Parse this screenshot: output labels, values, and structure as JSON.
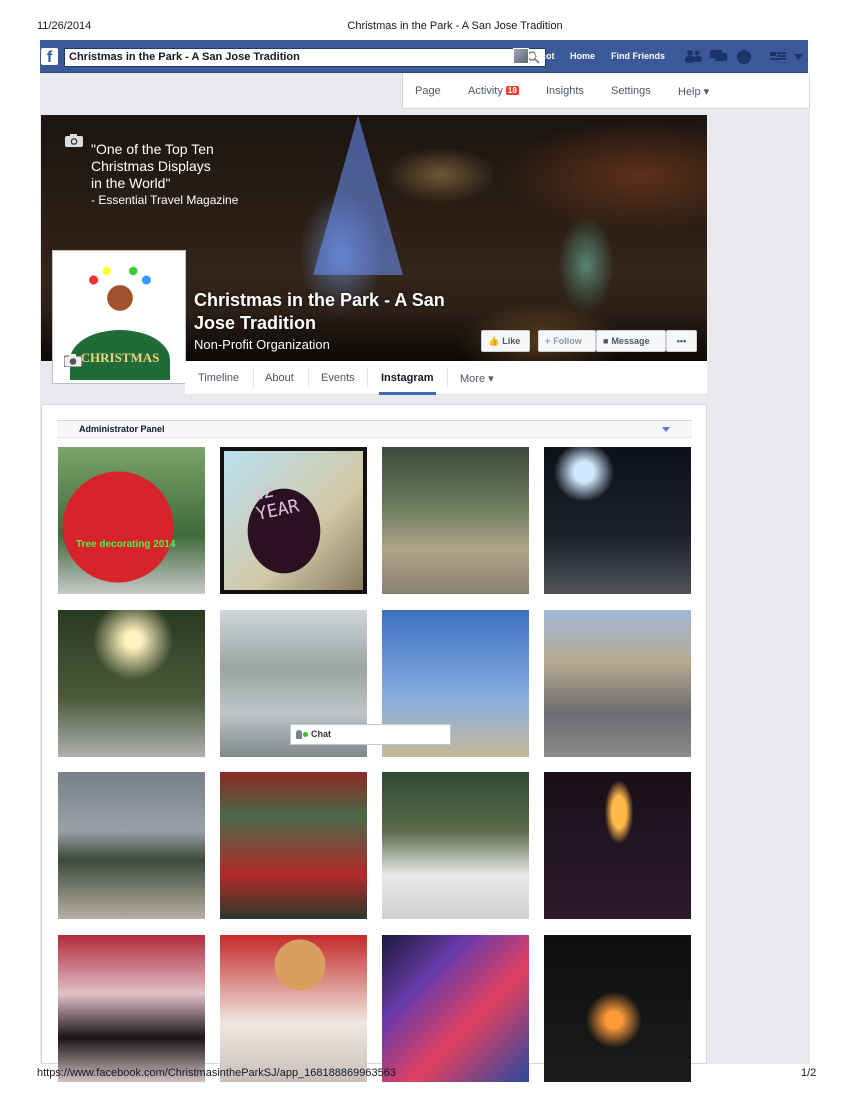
{
  "print_header": {
    "date": "11/26/2014",
    "title": "Christmas in the Park - A San Jose Tradition"
  },
  "print_footer": {
    "url": "https://www.facebook.com/ChristmasintheParkSJ/app_168188869963563",
    "page": "1/2"
  },
  "topbar": {
    "logo": "f",
    "search_value": "Christmas in the Park - A San Jose Tradition",
    "user_name": "Scot",
    "home": "Home",
    "find_friends": "Find Friends",
    "icons": [
      "friend-requests-icon",
      "messages-icon",
      "notifications-icon",
      "privacy-icon",
      "settings-icon"
    ]
  },
  "admin_tabs": {
    "page": "Page",
    "activity": "Activity",
    "activity_count": "18",
    "insights": "Insights",
    "settings": "Settings",
    "help": "Help ▾"
  },
  "cover": {
    "quote_line1": "\"One of the Top Ten",
    "quote_line2": "Christmas Displays",
    "quote_line3": "in the World\"",
    "quote_attr": " - Essential Travel Magazine"
  },
  "profile": {
    "name": "Christmas in the Park - A San Jose Tradition",
    "category": "Non-Profit Organization",
    "logo_text": "CHRISTMAS"
  },
  "actions": {
    "like": "Like",
    "follow": "Follow",
    "message": "Message",
    "more": "•••"
  },
  "page_tabs": {
    "timeline": "Timeline",
    "about": "About",
    "events": "Events",
    "instagram": "Instagram",
    "more": "More ▾"
  },
  "admin_panel": {
    "label": "Administrator Panel"
  },
  "photos": [
    {
      "alt": "red-ornament",
      "caption": "Tree decorating 2014"
    },
    {
      "alt": "hand-written-sign",
      "caption": "12\nYEAR"
    },
    {
      "alt": "family-photo",
      "caption": ""
    },
    {
      "alt": "night-street",
      "caption": ""
    },
    {
      "alt": "park-path",
      "caption": ""
    },
    {
      "alt": "orchard-booth",
      "caption": ""
    },
    {
      "alt": "palm-trees-building",
      "caption": ""
    },
    {
      "alt": "group-plaza",
      "caption": ""
    },
    {
      "alt": "tall-tree",
      "caption": ""
    },
    {
      "alt": "red-window-display",
      "caption": ""
    },
    {
      "alt": "fenced-display",
      "caption": ""
    },
    {
      "alt": "dark-light-display",
      "caption": ""
    },
    {
      "alt": "girl-red-house",
      "caption": ""
    },
    {
      "alt": "teddy-bear",
      "caption": ""
    },
    {
      "alt": "collage-lights",
      "caption": ""
    },
    {
      "alt": "fire-performer",
      "caption": ""
    }
  ],
  "chat": {
    "label": "Chat"
  },
  "colors": {
    "facebook_blue": "#3b5998",
    "badge_red": "#f03d25",
    "online_green": "#42b72a"
  }
}
